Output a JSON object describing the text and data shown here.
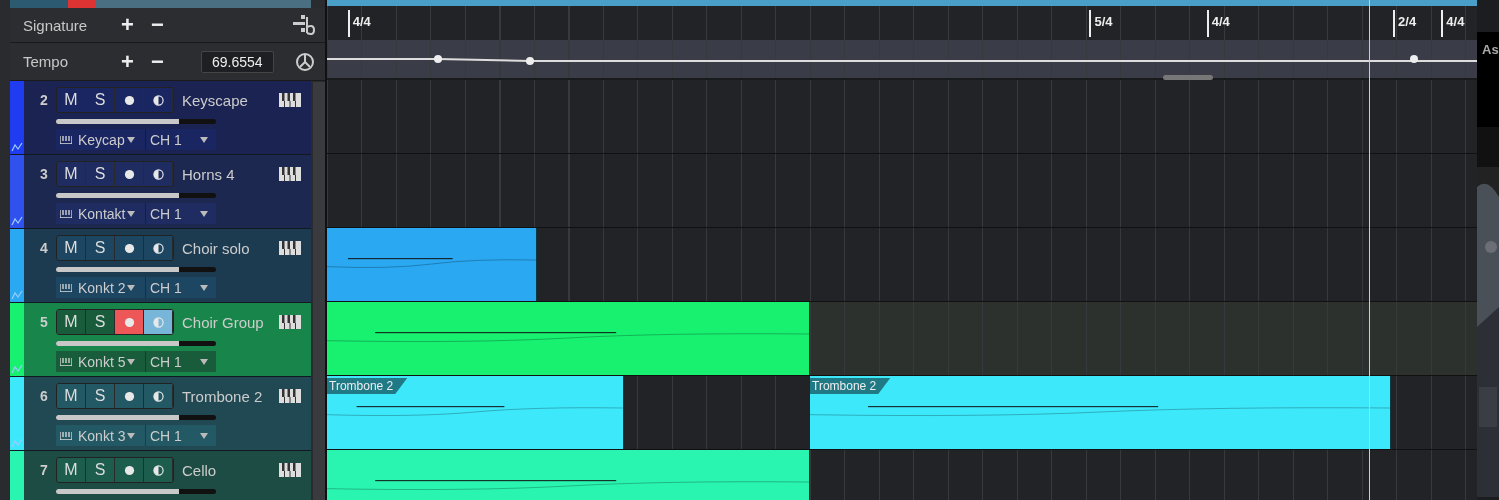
{
  "global_tracks": [
    {
      "kind": "signature",
      "label": "Signature",
      "add": "+",
      "remove": "−"
    },
    {
      "kind": "tempo",
      "label": "Tempo",
      "add": "+",
      "remove": "−",
      "value": "69.6554"
    }
  ],
  "ruler": {
    "signatures": [
      "4/4",
      "5/4",
      "4/4",
      "2/4",
      "4/4"
    ]
  },
  "tracks": [
    {
      "number": "2",
      "mute": "M",
      "solo": "S",
      "name": "Keyscape",
      "instrument": "Keycap",
      "channel": "CH 1",
      "color": "#1f3cf0",
      "selected": false,
      "record": false,
      "monitor": false,
      "level": 0.77
    },
    {
      "number": "3",
      "mute": "M",
      "solo": "S",
      "name": "Horns 4",
      "instrument": "Kontakt",
      "channel": "CH 1",
      "color": "#2f52ee",
      "selected": false,
      "record": false,
      "monitor": false,
      "level": 0.77
    },
    {
      "number": "4",
      "mute": "M",
      "solo": "S",
      "name": "Choir solo",
      "instrument": "Konkt 2",
      "channel": "CH 1",
      "color": "#2aa8f2",
      "selected": false,
      "record": false,
      "monitor": false,
      "level": 0.77,
      "clips": [
        {
          "kind": "clip"
        }
      ]
    },
    {
      "number": "5",
      "mute": "M",
      "solo": "S",
      "name": "Choir Group",
      "instrument": "Konkt 5",
      "channel": "CH 1",
      "color": "#18f070",
      "selected": true,
      "record": true,
      "monitor": true,
      "level": 0.77,
      "clips": [
        {
          "kind": "clip"
        }
      ]
    },
    {
      "number": "6",
      "mute": "M",
      "solo": "S",
      "name": "Trombone 2",
      "instrument": "Konkt 3",
      "channel": "CH 1",
      "color": "#3de8fb",
      "selected": false,
      "record": false,
      "monitor": false,
      "level": 0.77,
      "clips": [
        {
          "kind": "clip",
          "label": "Trombone 2"
        },
        {
          "kind": "clip",
          "label": "Trombone 2"
        }
      ]
    },
    {
      "number": "7",
      "mute": "M",
      "solo": "S",
      "name": "Cello",
      "color": "#2af5b0",
      "selected": false,
      "record": false,
      "monitor": false,
      "level": 0.77,
      "clips": [
        {
          "kind": "clip"
        }
      ]
    }
  ],
  "side_panel": {
    "title": "As"
  }
}
